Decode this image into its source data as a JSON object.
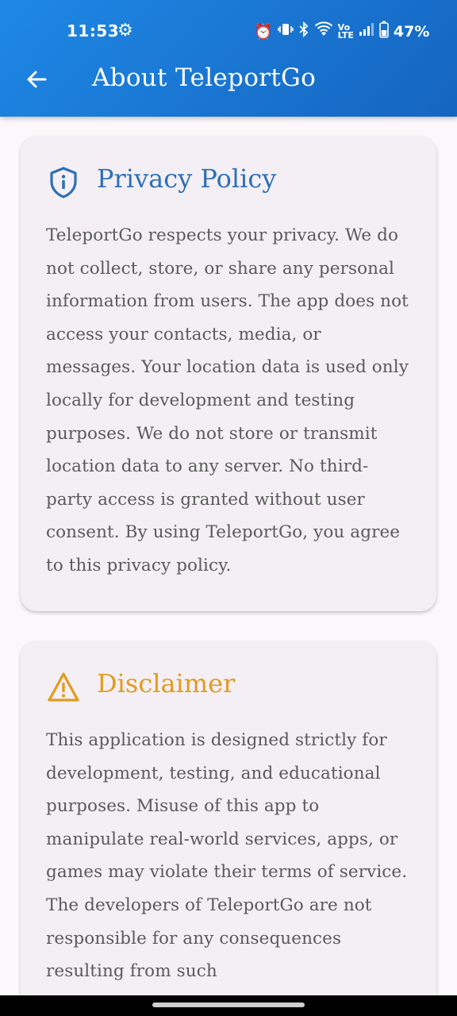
{
  "status_bar": {
    "time": "11:53",
    "battery": "47%",
    "icons": [
      "settings-icon",
      "alarm-icon",
      "vibrate-icon",
      "bluetooth-icon",
      "wifi-icon",
      "volte-icon",
      "signal-icon",
      "battery-icon"
    ]
  },
  "app_bar": {
    "title": "About TeleportGo",
    "back_icon": "arrow-left-icon",
    "background": "#1e88e5"
  },
  "privacy": {
    "title": "Privacy Policy",
    "icon": "shield-info-icon",
    "color": "#2d6fb8",
    "body": "TeleportGo respects your privacy. We do not collect, store, or share any personal information from users. The app does not access your contacts, media, or messages. Your location data is used only locally for development and testing purposes. We do not store or transmit location data to any server. No third-party access is granted without user consent. By using TeleportGo, you agree to this privacy policy."
  },
  "disclaimer": {
    "title": "Disclaimer",
    "icon": "warning-triangle-icon",
    "color": "#e39a1e",
    "body": "This application is designed strictly for development, testing, and educational purposes. Misuse of this app to manipulate real-world services, apps, or games may violate their terms of service. The developers of TeleportGo are not responsible for any consequences resulting from such"
  }
}
